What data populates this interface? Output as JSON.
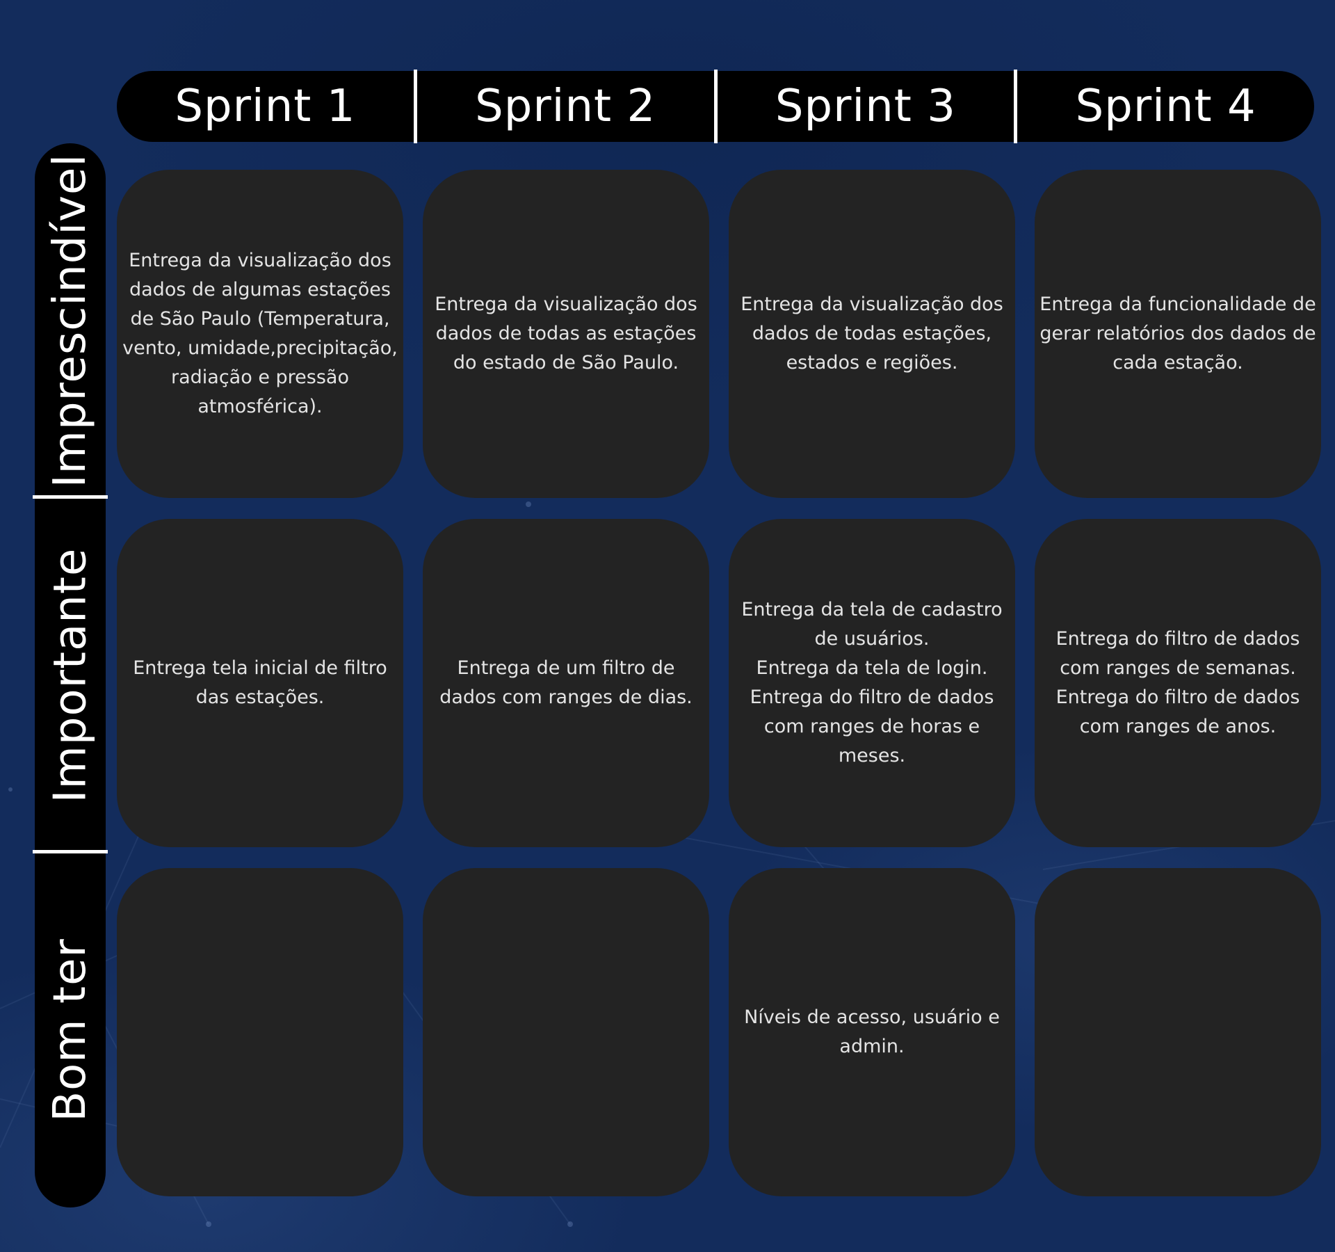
{
  "sprints": [
    "Sprint 1",
    "Sprint 2",
    "Sprint 3",
    "Sprint 4"
  ],
  "priorities": [
    "Imprescindível",
    "Importante",
    "Bom ter"
  ],
  "cards": [
    [
      "Entrega da visualização dos\ndados de algumas estações\nde São Paulo (Temperatura,\nvento, umidade,precipitação,\nradiação e pressão\natmosférica).",
      "Entrega da visualização dos\ndados de todas as estações\ndo estado de São Paulo.",
      "Entrega da visualização dos\ndados de todas estações,\nestados e regiões.",
      "Entrega da funcionalidade de\ngerar relatórios dos dados de\ncada estação."
    ],
    [
      "Entrega tela inicial de filtro\ndas estações.",
      "Entrega de um filtro de\ndados com ranges de dias.",
      "Entrega da tela de cadastro\nde usuários.\nEntrega da tela de login.\nEntrega do filtro de dados\ncom ranges de horas e\nmeses.",
      "Entrega do filtro de dados\ncom ranges de semanas.\nEntrega do filtro de dados\ncom ranges de anos."
    ],
    [
      "",
      "",
      "Níveis de acesso, usuário e\nadmin.",
      ""
    ]
  ]
}
